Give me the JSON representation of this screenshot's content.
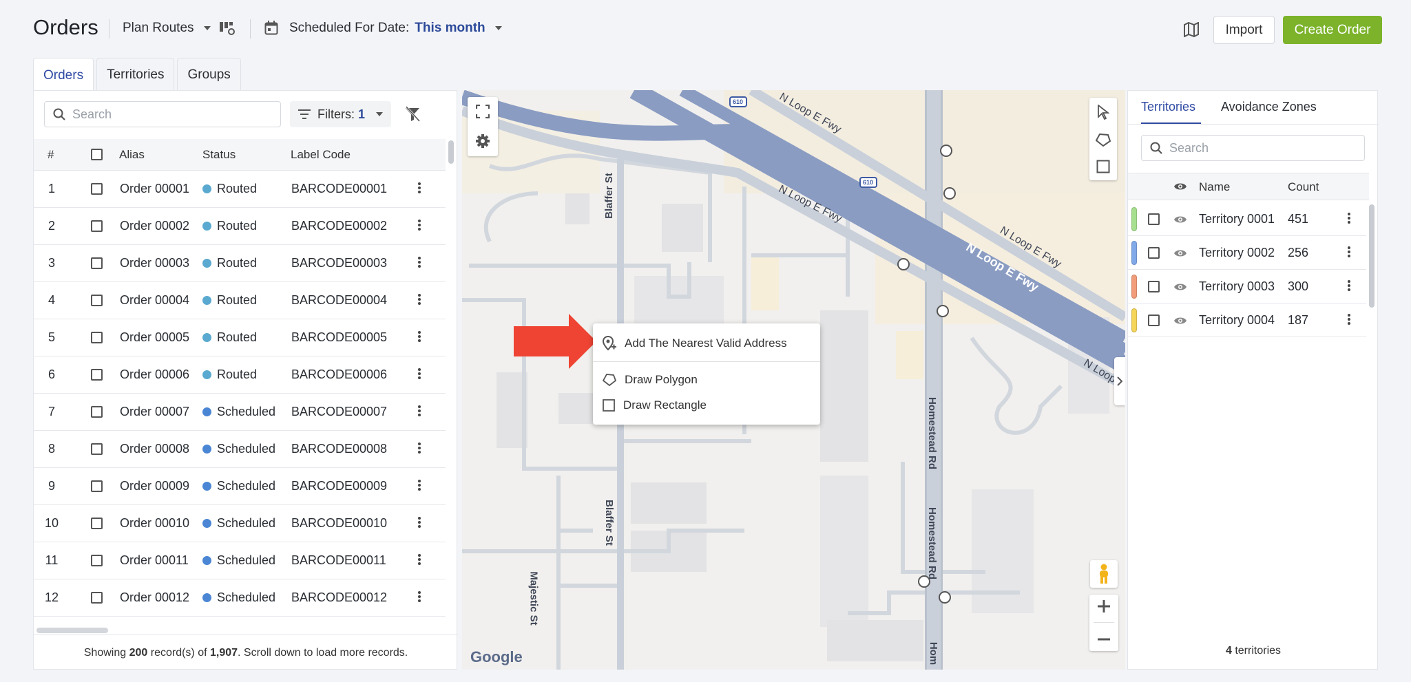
{
  "header": {
    "title": "Orders",
    "plan_routes": "Plan Routes",
    "scheduled_label": "Scheduled For Date:",
    "scheduled_value": "This month",
    "import_label": "Import",
    "create_label": "Create Order"
  },
  "tabs": [
    {
      "label": "Orders"
    },
    {
      "label": "Territories"
    },
    {
      "label": "Groups"
    }
  ],
  "orders_panel": {
    "search_placeholder": "Search",
    "filters_label": "Filters:",
    "filters_count": "1",
    "columns": {
      "num": "#",
      "alias": "Alias",
      "status": "Status",
      "label_code": "Label Code"
    },
    "rows": [
      {
        "n": "1",
        "alias": "Order 00001",
        "status": "Routed",
        "code": "BARCODE00001"
      },
      {
        "n": "2",
        "alias": "Order 00002",
        "status": "Routed",
        "code": "BARCODE00002"
      },
      {
        "n": "3",
        "alias": "Order 00003",
        "status": "Routed",
        "code": "BARCODE00003"
      },
      {
        "n": "4",
        "alias": "Order 00004",
        "status": "Routed",
        "code": "BARCODE00004"
      },
      {
        "n": "5",
        "alias": "Order 00005",
        "status": "Routed",
        "code": "BARCODE00005"
      },
      {
        "n": "6",
        "alias": "Order 00006",
        "status": "Routed",
        "code": "BARCODE00006"
      },
      {
        "n": "7",
        "alias": "Order 00007",
        "status": "Scheduled",
        "code": "BARCODE00007"
      },
      {
        "n": "8",
        "alias": "Order 00008",
        "status": "Scheduled",
        "code": "BARCODE00008"
      },
      {
        "n": "9",
        "alias": "Order 00009",
        "status": "Scheduled",
        "code": "BARCODE00009"
      },
      {
        "n": "10",
        "alias": "Order 00010",
        "status": "Scheduled",
        "code": "BARCODE00010"
      },
      {
        "n": "11",
        "alias": "Order 00011",
        "status": "Scheduled",
        "code": "BARCODE00011"
      },
      {
        "n": "12",
        "alias": "Order 00012",
        "status": "Scheduled",
        "code": "BARCODE00012"
      }
    ],
    "status_colors": {
      "Routed": "#5aa9d0",
      "Scheduled": "#4a86d4"
    },
    "footer": {
      "pre": "Showing ",
      "shown": "200",
      "mid": " record(s) of ",
      "total": "1,907",
      "post": ". Scroll down to load more records."
    }
  },
  "map": {
    "labels": {
      "nloop1": "N Loop E Fwy",
      "nloop2": "N Loop E Fwy",
      "nloop3": "N Loop E Fwy",
      "nloop4": "N Loop E Fwy",
      "nloop5": "N Loop",
      "blaffer1": "Blaffer St",
      "blaffer2": "Blaffer St",
      "homestead1": "Homestead Rd",
      "homestead2": "Homestead Rd",
      "homestead3": "Hom",
      "majestic": "Majestic St",
      "shield1": "610",
      "shield2": "610",
      "google": "Google"
    },
    "context_menu": {
      "add_nearest": "Add The Nearest Valid Address",
      "draw_polygon": "Draw Polygon",
      "draw_rectangle": "Draw Rectangle"
    },
    "colors": {
      "highway": "#8a9cc2",
      "road": "#c9d0da",
      "arrow": "#ef4433"
    }
  },
  "territories_panel": {
    "tab_territories": "Territories",
    "tab_avoidance": "Avoidance Zones",
    "search_placeholder": "Search",
    "columns": {
      "name": "Name",
      "count": "Count"
    },
    "rows": [
      {
        "name": "Territory 0001",
        "count": "451",
        "color": "#a6e08f"
      },
      {
        "name": "Territory 0002",
        "count": "256",
        "color": "#7fa9e8"
      },
      {
        "name": "Territory 0003",
        "count": "300",
        "color": "#f29d7a"
      },
      {
        "name": "Territory 0004",
        "count": "187",
        "color": "#f5d55a"
      }
    ],
    "footer_count": "4",
    "footer_label": " territories"
  }
}
